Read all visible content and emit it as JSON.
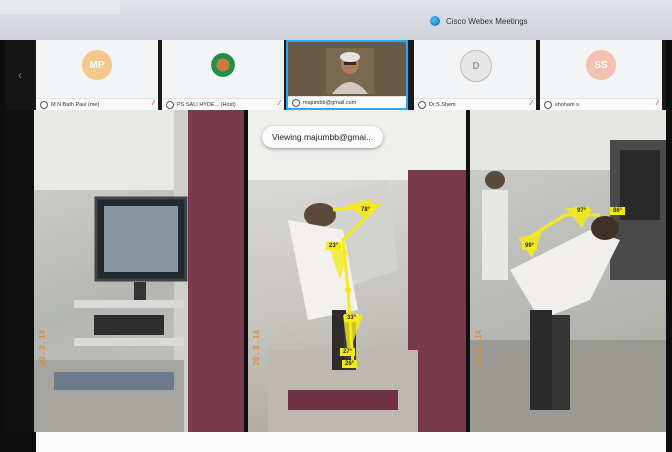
{
  "window": {
    "app_title": "Cisco Webex Meetings"
  },
  "participants": [
    {
      "initials": "MP",
      "name": "M N Bath Paul (me)",
      "muted_icon": "mic-muted-icon",
      "avatar_color": "#f3c88a",
      "text_color": "#ffffff"
    },
    {
      "initials": "",
      "name": "PS SALI HYDE... (Host)",
      "muted_icon": "mic-muted-icon",
      "avatar_color": "#1f8f4d",
      "text_color": "#ffffff"
    },
    {
      "initials": "",
      "name": "majumbb@gmail.com",
      "muted_icon": "",
      "avatar_color": "#6b5a44",
      "text_color": "#ffffff"
    },
    {
      "initials": "D",
      "name": "Dr.S.Shem",
      "muted_icon": "mic-muted-icon",
      "avatar_color": "#e6e6e6",
      "text_color": "#999999"
    },
    {
      "initials": "SS",
      "name": "shoham s",
      "muted_icon": "mic-muted-icon",
      "avatar_color": "#f3c1b0",
      "text_color": "#ffffff"
    }
  ],
  "share": {
    "viewing_text": "Viewing majumbb@gmai..."
  },
  "overlays": {
    "panel2_angles": [
      "78°",
      "23°",
      "33°",
      "27°",
      "26°"
    ],
    "panel3_angles": [
      "99°",
      "97°",
      "86°"
    ]
  },
  "accent": "#2aa7ff",
  "angle_tag_color": "#f5ea19"
}
